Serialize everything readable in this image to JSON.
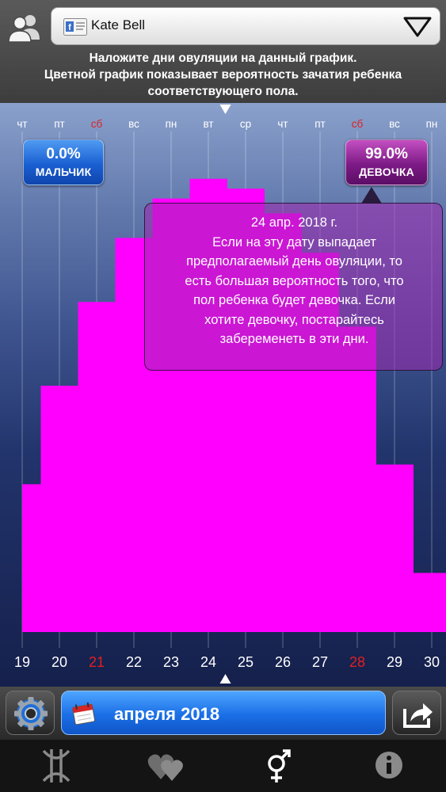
{
  "header": {
    "profile_name": "Kate Bell",
    "instructions": [
      "Наложите дни овуляции на данный график.",
      "Цветной график показывает вероятность зачатия ребенка",
      "соответствующего пола."
    ]
  },
  "badges": {
    "boy": {
      "percent": "0.0%",
      "label": "МАЛЬЧИК"
    },
    "girl": {
      "percent": "99.0%",
      "label": "ДЕВОЧКА"
    }
  },
  "tooltip": {
    "date": "24 апр. 2018 г.",
    "lines": [
      "Если на эту дату выпадает",
      "предполагаемый день овуляции, то",
      "есть большая вероятность того, что",
      "пол ребенка будет девочка. Если",
      "хотите девочку, постарайтесь",
      "забеременеть в эти дни."
    ]
  },
  "toolbar": {
    "month_label": "апреля 2018"
  },
  "colors": {
    "girl": "#ff00ff",
    "boy": "#1a5fd2",
    "weekend": "#e02020",
    "weekday": "#ffffff"
  },
  "chart_data": {
    "type": "bar",
    "categories": [
      "19",
      "20",
      "21",
      "22",
      "23",
      "24",
      "25",
      "26",
      "27",
      "28",
      "29",
      "30"
    ],
    "weekdays": [
      "чт",
      "пт",
      "сб",
      "вс",
      "пн",
      "вт",
      "ср",
      "чт",
      "пт",
      "сб",
      "вс",
      "пн"
    ],
    "weekend_flags": [
      false,
      false,
      true,
      false,
      false,
      false,
      false,
      false,
      false,
      true,
      false,
      false
    ],
    "series": [
      {
        "values": [
          30,
          50,
          67,
          80,
          88,
          92,
          90,
          85,
          77,
          62,
          34,
          12
        ]
      }
    ],
    "ylim": [
      0,
      100
    ],
    "selected_date": "24",
    "grid": true
  }
}
